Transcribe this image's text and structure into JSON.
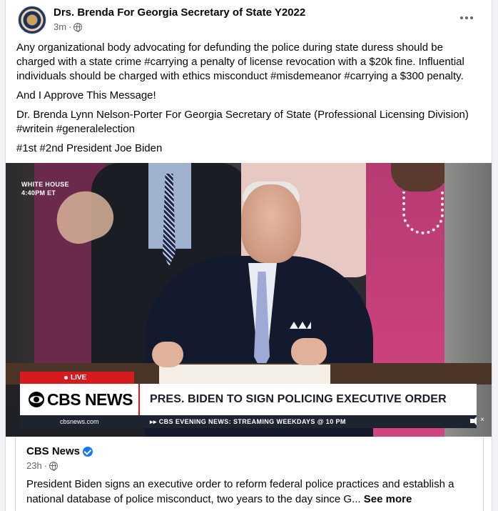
{
  "post": {
    "author": "Drs. Brenda For Georgia Secretary of State Y2022",
    "time": "3m",
    "separator": "·",
    "paragraphs": [
      "Any organizational body advocating for defunding the police during state duress should be charged with a state crime #carrying a penalty of license revocation with a $20k fine. Influential individuals should be charged with ethics misconduct #misdemeanor #carrying a $300 penalty.",
      "And I Approve This Message!",
      "Dr. Brenda Lynn Nelson-Porter For Georgia Secretary of State (Professional Licensing Division)",
      "#writein #generalelection",
      "#1st #2nd President Joe Biden"
    ]
  },
  "video": {
    "location_badge": "WHITE HOUSE",
    "time_badge": "4:40PM ET",
    "live_label": "LIVE",
    "network": "CBS NEWS",
    "headline": "PRES. BIDEN TO SIGN POLICING EXECUTIVE ORDER",
    "site": "cbsnews.com",
    "ticker": "▸▸ CBS EVENING NEWS: STREAMING WEEKDAYS @ 10 PM",
    "mute_x": "×"
  },
  "shared": {
    "name": "CBS News",
    "time": "23h",
    "separator": "·",
    "text": "President Biden signs an executive order to reform federal police practices and establish a national database of police misconduct, two years to the day since G... ",
    "see_more": "See more"
  },
  "colors": {
    "cbs_red": "#d71920",
    "verified_blue": "#1877f2",
    "meta_gray": "#65676b"
  },
  "icons": [
    "globe-icon",
    "more-icon",
    "cbs-eye-icon",
    "verified-icon",
    "mute-icon"
  ]
}
